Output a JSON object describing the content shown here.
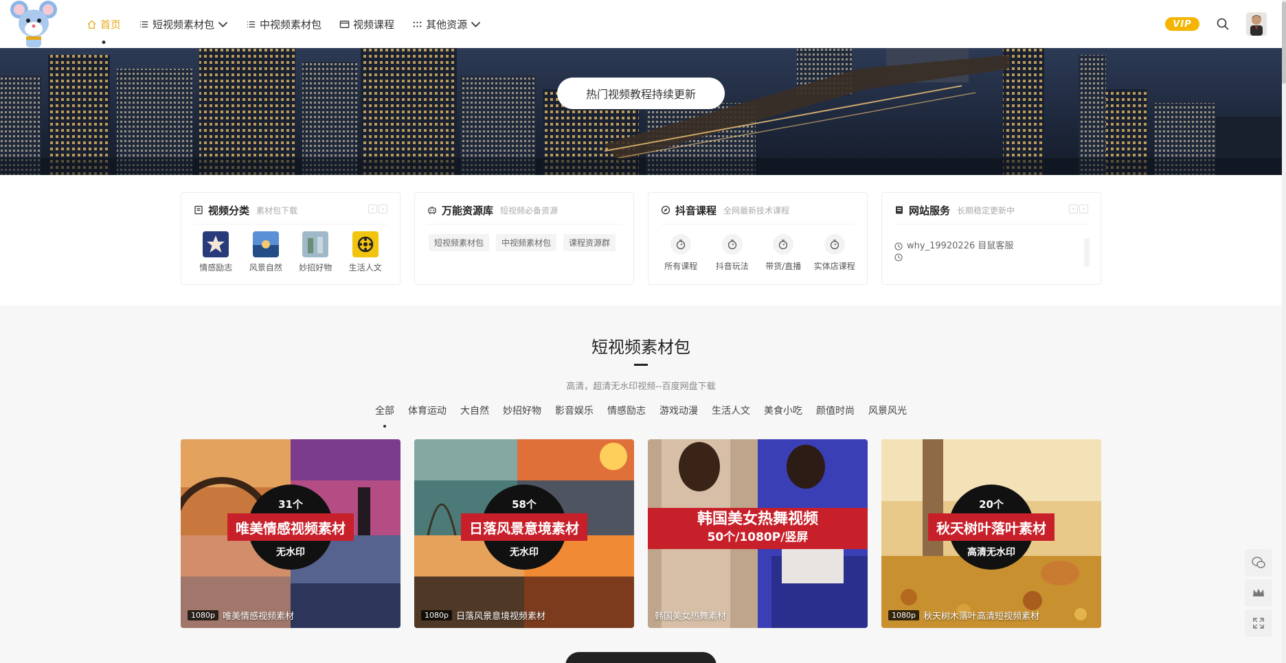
{
  "header": {
    "nav": [
      {
        "label": "首页",
        "icon": "home-icon",
        "active": true
      },
      {
        "label": "短视频素材包",
        "icon": "list-icon",
        "dropdown": true
      },
      {
        "label": "中视频素材包",
        "icon": "list-icon"
      },
      {
        "label": "视频课程",
        "icon": "window-icon"
      },
      {
        "label": "其他资源",
        "icon": "grid-dots-icon",
        "dropdown": true
      }
    ],
    "vip_label": "VIP"
  },
  "banner": {
    "button": "热门视频教程持续更新"
  },
  "cards": {
    "video_category": {
      "title": "视频分类",
      "subtitle": "素材包下载",
      "items": [
        "情感励志",
        "风景自然",
        "妙招好物",
        "生活人文"
      ]
    },
    "resources": {
      "title": "万能资源库",
      "subtitle": "短视频必备资源",
      "tags": [
        "短视频素材包",
        "中视频素材包",
        "课程资源群"
      ]
    },
    "douyin": {
      "title": "抖音课程",
      "subtitle": "全网最新技术课程",
      "items": [
        "所有课程",
        "抖音玩法",
        "带货/直播",
        "实体店课程"
      ]
    },
    "service": {
      "title": "网站服务",
      "subtitle": "长期稳定更新中",
      "lines": [
        "why_19920226 目鼠客服",
        ""
      ]
    }
  },
  "section": {
    "title": "短视频素材包",
    "subtitle": "高清，超清无水印视频--百度网盘下载",
    "filters": [
      "全部",
      "体育运动",
      "大自然",
      "妙招好物",
      "影音娱乐",
      "情感励志",
      "游戏动漫",
      "生活人文",
      "美食小吃",
      "颜值时尚",
      "风景风光"
    ],
    "active_filter": "全部",
    "items": [
      {
        "count": "31个",
        "headline": "唯美情感视频素材",
        "tagline": "无水印",
        "badge": "1080p",
        "caption": "唯美情感视频素材"
      },
      {
        "count": "58个",
        "headline": "日落风景意境素材",
        "tagline": "无水印",
        "badge": "1080p",
        "caption": "日落风景意境视频素材"
      },
      {
        "headline": "韩国美女热舞视频",
        "tagline": "50个/1080P/竖屏",
        "caption": "韩国美女热舞素材"
      },
      {
        "count": "20个",
        "headline": "秋天树叶落叶素材",
        "tagline": "高清无水印",
        "badge": "1080p",
        "caption": "秋天树木落叶高清短视频素材"
      }
    ]
  },
  "colors": {
    "accent": "#e6a817",
    "vip": "#f4b400",
    "red_banner": "#c8202a"
  }
}
